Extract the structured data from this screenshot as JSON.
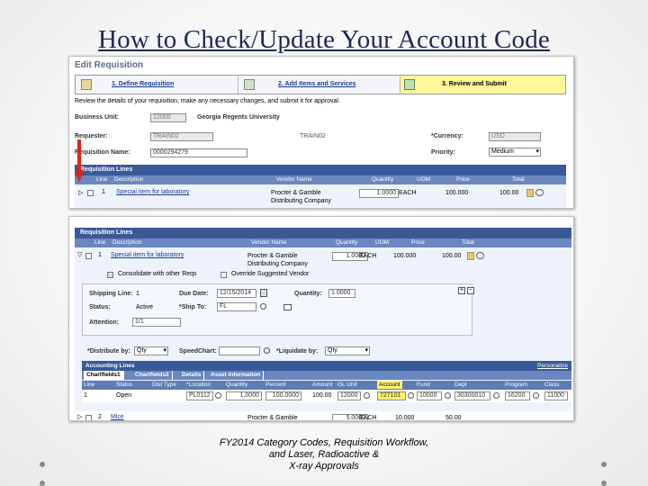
{
  "title": "How to Check/Update Your Account Code",
  "caption": [
    "FY2014 Category Codes, Requisition Workflow,",
    "and Laser, Radioactive &",
    "X-ray Approvals"
  ],
  "screen1": {
    "header": "Edit Requisition",
    "steps": [
      {
        "label": "1. Define Requisition"
      },
      {
        "label": "2. Add Items and Services"
      },
      {
        "label": "3. Review and Submit"
      }
    ],
    "instruction": "Review the details of your requisition, make any necessary changes, and submit it for approval.",
    "business_unit_label": "Business Unit:",
    "business_unit_value": "12000",
    "business_unit_name": "Georgia Regents University",
    "requester_label": "Requester:",
    "requester_value": "TRAIN02",
    "requester_name": "TRAIN02",
    "req_name_label": "Requisition Name:",
    "req_name_value": "0000294279",
    "currency_label": "*Currency:",
    "currency_value": "USD",
    "priority_label": "Priority:",
    "priority_value": "Medium",
    "lines_title": "Requisition Lines",
    "columns": [
      "Line",
      "Description",
      "Vendor Name",
      "Quantity",
      "UOM",
      "Price",
      "Total"
    ],
    "row": {
      "line": "1",
      "description": "Special item for laboratory",
      "vendor": "Procter & Gamble",
      "vendor2": "Distributing Company",
      "quantity": "1.0000",
      "uom": "EACH",
      "price": "100.000",
      "total": "100.00"
    }
  },
  "screen2": {
    "lines_title": "Requisition Lines",
    "columns": [
      "Line",
      "Description",
      "Vendor Name",
      "Quantity",
      "UOM",
      "Price",
      "Total"
    ],
    "row": {
      "line": "1",
      "description": "Special item for laboratory",
      "vendor": "Procter & Gamble",
      "vendor2": "Distributing Company",
      "quantity": "1.0000",
      "uom": "EACH",
      "price": "100.000",
      "total": "100.00"
    },
    "consolidate_label": "Consolidate with other Reqs",
    "override_label": "Override Suggested Vendor",
    "shipping_line_label": "Shipping Line:",
    "shipping_line_value": "1",
    "due_date_label": "Due Date:",
    "due_date_value": "12/15/2014",
    "quantity_label": "Quantity:",
    "quantity_value": "1.0000",
    "status_label": "Status:",
    "status_value": "Active",
    "ship_to_label": "*Ship To:",
    "ship_to_value": "FL",
    "attention_label": "Attention:",
    "attention_value": "1/1",
    "distribute_label": "*Distribute by:",
    "distribute_value": "Qty",
    "speedchart_label": "SpeedChart:",
    "liquidate_label": "*Liquidate by:",
    "liquidate_value": "Qty",
    "accounting_title": "Accounting Lines",
    "personalize": "Personalize",
    "tabs": [
      "Chartfields1",
      "Chartfields2",
      "Details",
      "Asset Information"
    ],
    "acct_columns": [
      "Line",
      "Status",
      "Dist Type",
      "*Location",
      "Quantity",
      "Percent",
      "Amount",
      "GL Unit",
      "Account",
      "Fund",
      "Dept",
      "Program",
      "Class"
    ],
    "acct_row": {
      "line": "1",
      "status": "Open",
      "dist_type": "",
      "location": "PL0112",
      "quantity": "1.0000",
      "percent": "100.0000",
      "amount": "100.00",
      "gl_unit": "12000",
      "account": "727101",
      "fund": "10000",
      "dept": "30300010",
      "program": "16200",
      "class": "11000"
    },
    "row2": {
      "line": "2",
      "description": "Mice",
      "vendor": "Procter & Gamble",
      "quantity": "5.0000",
      "uom": "EACH",
      "price": "10.000",
      "total": "50.00"
    }
  },
  "colors": {
    "title": "#1f2a55",
    "grid_header": "#3a5998",
    "column_header": "#6a87bf",
    "highlight": "#fff36b",
    "arrow": "#d9261c"
  }
}
